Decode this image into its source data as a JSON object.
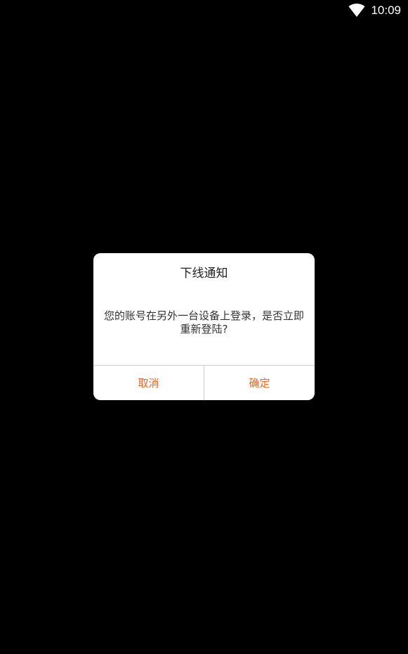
{
  "status_bar": {
    "time": "10:09",
    "wifi_icon": "wifi-icon"
  },
  "dialog": {
    "title": "下线通知",
    "message": "您的账号在另外一台设备上登录，是否立即重新登陆?",
    "cancel_label": "取消",
    "confirm_label": "确定"
  },
  "colors": {
    "background": "#000000",
    "dialog_bg": "#ffffff",
    "accent": "#f26522",
    "title_text": "#222222",
    "divider": "#cfcfcf"
  }
}
